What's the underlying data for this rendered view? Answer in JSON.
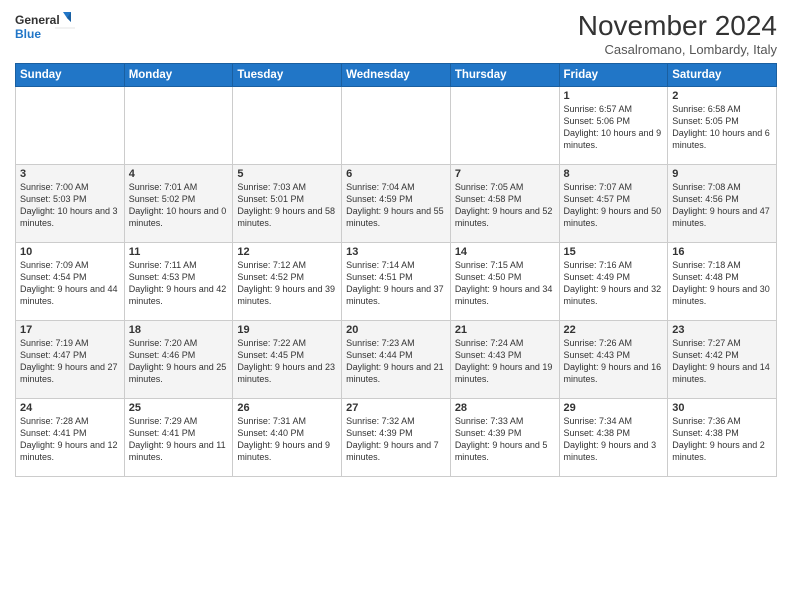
{
  "logo": {
    "line1": "General",
    "line2": "Blue"
  },
  "title": "November 2024",
  "subtitle": "Casalromano, Lombardy, Italy",
  "days_header": [
    "Sunday",
    "Monday",
    "Tuesday",
    "Wednesday",
    "Thursday",
    "Friday",
    "Saturday"
  ],
  "weeks": [
    [
      {
        "num": "",
        "info": ""
      },
      {
        "num": "",
        "info": ""
      },
      {
        "num": "",
        "info": ""
      },
      {
        "num": "",
        "info": ""
      },
      {
        "num": "",
        "info": ""
      },
      {
        "num": "1",
        "info": "Sunrise: 6:57 AM\nSunset: 5:06 PM\nDaylight: 10 hours and 9 minutes."
      },
      {
        "num": "2",
        "info": "Sunrise: 6:58 AM\nSunset: 5:05 PM\nDaylight: 10 hours and 6 minutes."
      }
    ],
    [
      {
        "num": "3",
        "info": "Sunrise: 7:00 AM\nSunset: 5:03 PM\nDaylight: 10 hours and 3 minutes."
      },
      {
        "num": "4",
        "info": "Sunrise: 7:01 AM\nSunset: 5:02 PM\nDaylight: 10 hours and 0 minutes."
      },
      {
        "num": "5",
        "info": "Sunrise: 7:03 AM\nSunset: 5:01 PM\nDaylight: 9 hours and 58 minutes."
      },
      {
        "num": "6",
        "info": "Sunrise: 7:04 AM\nSunset: 4:59 PM\nDaylight: 9 hours and 55 minutes."
      },
      {
        "num": "7",
        "info": "Sunrise: 7:05 AM\nSunset: 4:58 PM\nDaylight: 9 hours and 52 minutes."
      },
      {
        "num": "8",
        "info": "Sunrise: 7:07 AM\nSunset: 4:57 PM\nDaylight: 9 hours and 50 minutes."
      },
      {
        "num": "9",
        "info": "Sunrise: 7:08 AM\nSunset: 4:56 PM\nDaylight: 9 hours and 47 minutes."
      }
    ],
    [
      {
        "num": "10",
        "info": "Sunrise: 7:09 AM\nSunset: 4:54 PM\nDaylight: 9 hours and 44 minutes."
      },
      {
        "num": "11",
        "info": "Sunrise: 7:11 AM\nSunset: 4:53 PM\nDaylight: 9 hours and 42 minutes."
      },
      {
        "num": "12",
        "info": "Sunrise: 7:12 AM\nSunset: 4:52 PM\nDaylight: 9 hours and 39 minutes."
      },
      {
        "num": "13",
        "info": "Sunrise: 7:14 AM\nSunset: 4:51 PM\nDaylight: 9 hours and 37 minutes."
      },
      {
        "num": "14",
        "info": "Sunrise: 7:15 AM\nSunset: 4:50 PM\nDaylight: 9 hours and 34 minutes."
      },
      {
        "num": "15",
        "info": "Sunrise: 7:16 AM\nSunset: 4:49 PM\nDaylight: 9 hours and 32 minutes."
      },
      {
        "num": "16",
        "info": "Sunrise: 7:18 AM\nSunset: 4:48 PM\nDaylight: 9 hours and 30 minutes."
      }
    ],
    [
      {
        "num": "17",
        "info": "Sunrise: 7:19 AM\nSunset: 4:47 PM\nDaylight: 9 hours and 27 minutes."
      },
      {
        "num": "18",
        "info": "Sunrise: 7:20 AM\nSunset: 4:46 PM\nDaylight: 9 hours and 25 minutes."
      },
      {
        "num": "19",
        "info": "Sunrise: 7:22 AM\nSunset: 4:45 PM\nDaylight: 9 hours and 23 minutes."
      },
      {
        "num": "20",
        "info": "Sunrise: 7:23 AM\nSunset: 4:44 PM\nDaylight: 9 hours and 21 minutes."
      },
      {
        "num": "21",
        "info": "Sunrise: 7:24 AM\nSunset: 4:43 PM\nDaylight: 9 hours and 19 minutes."
      },
      {
        "num": "22",
        "info": "Sunrise: 7:26 AM\nSunset: 4:43 PM\nDaylight: 9 hours and 16 minutes."
      },
      {
        "num": "23",
        "info": "Sunrise: 7:27 AM\nSunset: 4:42 PM\nDaylight: 9 hours and 14 minutes."
      }
    ],
    [
      {
        "num": "24",
        "info": "Sunrise: 7:28 AM\nSunset: 4:41 PM\nDaylight: 9 hours and 12 minutes."
      },
      {
        "num": "25",
        "info": "Sunrise: 7:29 AM\nSunset: 4:41 PM\nDaylight: 9 hours and 11 minutes."
      },
      {
        "num": "26",
        "info": "Sunrise: 7:31 AM\nSunset: 4:40 PM\nDaylight: 9 hours and 9 minutes."
      },
      {
        "num": "27",
        "info": "Sunrise: 7:32 AM\nSunset: 4:39 PM\nDaylight: 9 hours and 7 minutes."
      },
      {
        "num": "28",
        "info": "Sunrise: 7:33 AM\nSunset: 4:39 PM\nDaylight: 9 hours and 5 minutes."
      },
      {
        "num": "29",
        "info": "Sunrise: 7:34 AM\nSunset: 4:38 PM\nDaylight: 9 hours and 3 minutes."
      },
      {
        "num": "30",
        "info": "Sunrise: 7:36 AM\nSunset: 4:38 PM\nDaylight: 9 hours and 2 minutes."
      }
    ]
  ]
}
